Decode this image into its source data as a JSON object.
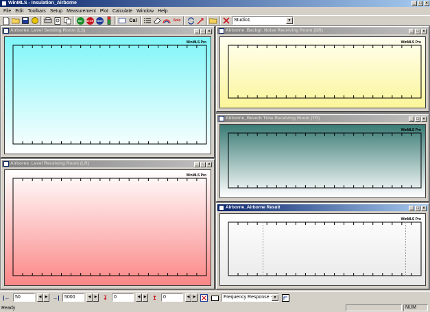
{
  "app": {
    "title": "WinMLS - Insulation_Airborne"
  },
  "menu": [
    "File",
    "Edit",
    "Toolbars",
    "Setup",
    "Measurement",
    "Plot",
    "Calculate",
    "Window",
    "Help"
  ],
  "toolbar": {
    "go_label": "GO",
    "stop_label": "STOP",
    "test_label": "TEST",
    "cal_label": "Cal",
    "solo_label": "Solo",
    "setup_combo_value": "Studio1"
  },
  "windows": [
    {
      "title": "Airborne_Level Sending Room (LS)",
      "watermark": "WinMLS Pro",
      "bg_top": "#7ef5f8",
      "bg_bottom": "#ffffff"
    },
    {
      "title": "Airborne_Level Receiving Room (LR)",
      "watermark": "WinMLS Pro",
      "bg_top": "#ffffff",
      "bg_bottom": "#fb8686"
    },
    {
      "title": "Airborne_Backgr. Noise Receiving Room (BR)",
      "watermark": "WinMLS Pro",
      "bg_top": "#fffff0",
      "bg_bottom": "#fbf59a"
    },
    {
      "title": "Airborne_Reverb Time Receiving Room (TR)",
      "watermark": "WinMLS Pro",
      "bg_top": "#3a7b75",
      "bg_bottom": "#ffffff"
    },
    {
      "title": "Airborne_Airborne Result",
      "watermark": "WinMLS Pro",
      "bg_top": "#ffffff",
      "bg_bottom": "#e8e8e8"
    }
  ],
  "bottombar": {
    "start_value": "50",
    "end_value": "5000",
    "lower_value": "0",
    "upper_value": "0",
    "plot_type": "Frequency Response - S"
  },
  "status": {
    "left": "Ready",
    "num": "NUM"
  }
}
